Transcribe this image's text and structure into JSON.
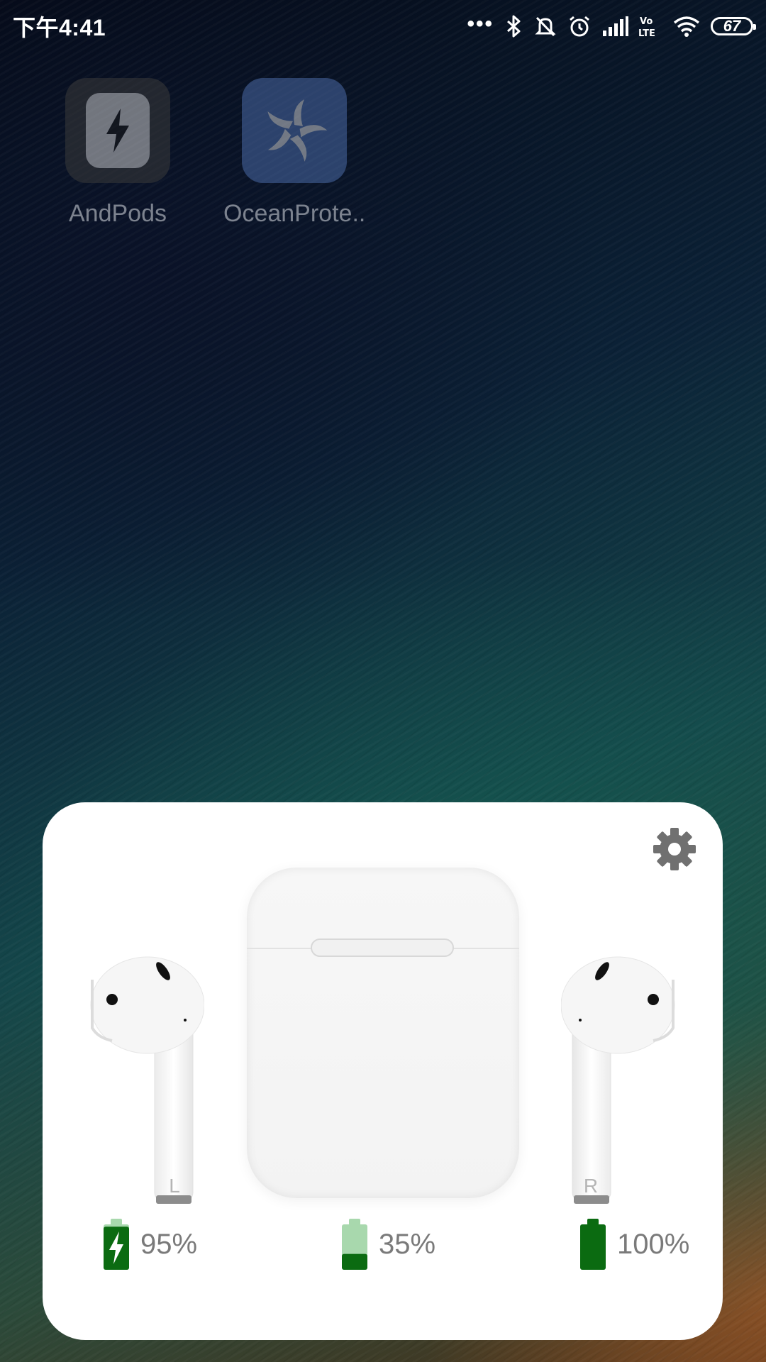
{
  "status_bar": {
    "time": "下午4:41",
    "overflow_dots": "•••",
    "network_label": "Vo LTE",
    "battery_level": "67"
  },
  "home_apps": [
    {
      "label": "AndPods",
      "icon": "lightning-icon"
    },
    {
      "label": "OceanProte..",
      "icon": "pinwheel-icon"
    }
  ],
  "airpods_popup": {
    "settings_icon": "gear-icon",
    "left_pod": {
      "side_label": "L",
      "battery_text": "95%",
      "battery_fraction": 0.95,
      "charging": true
    },
    "case": {
      "battery_text": "35%",
      "battery_fraction": 0.35,
      "charging": false
    },
    "right_pod": {
      "side_label": "R",
      "battery_text": "100%",
      "battery_fraction": 1.0,
      "charging": false
    },
    "colors": {
      "battery_green": "#0b6b11",
      "battery_light": "#a8d8ad",
      "text_gray": "#7a7a7a"
    }
  }
}
